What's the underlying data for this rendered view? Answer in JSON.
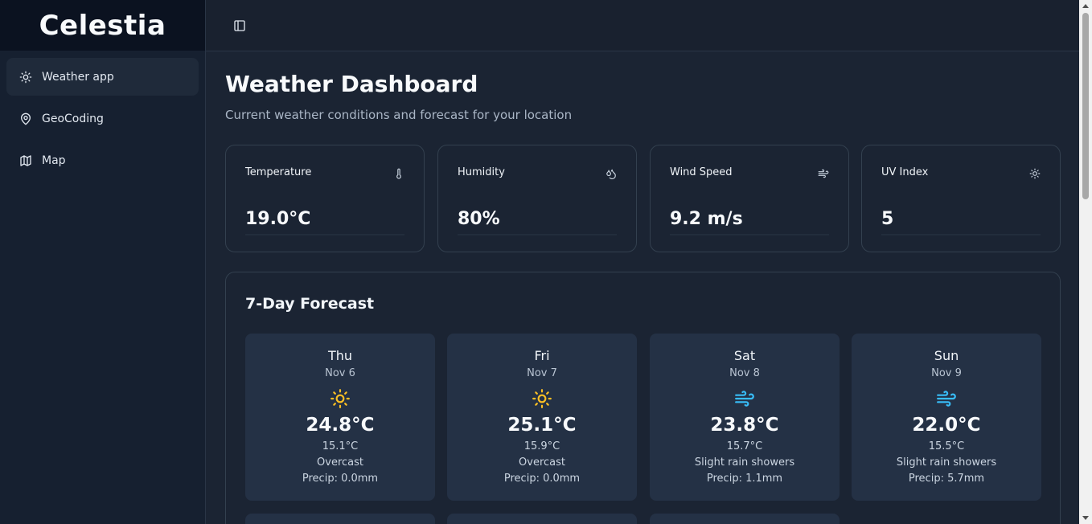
{
  "app": {
    "brand": "Celestia"
  },
  "sidebar": {
    "items": [
      {
        "label": "Weather app",
        "icon": "sun-icon",
        "active": true
      },
      {
        "label": "GeoCoding",
        "icon": "map-pin-icon"
      },
      {
        "label": "Map",
        "icon": "map-icon"
      }
    ]
  },
  "header": {
    "toggle_icon": "sidebar-toggle-icon"
  },
  "page": {
    "title": "Weather Dashboard",
    "subtitle": "Current weather conditions and forecast for your location"
  },
  "stats": [
    {
      "label": "Temperature",
      "value": "19.0°C",
      "icon": "thermometer-icon"
    },
    {
      "label": "Humidity",
      "value": "80%",
      "icon": "droplets-icon"
    },
    {
      "label": "Wind Speed",
      "value": "9.2 m/s",
      "icon": "wind-icon"
    },
    {
      "label": "UV Index",
      "value": "5",
      "icon": "sun-icon"
    }
  ],
  "forecast": {
    "title": "7-Day Forecast",
    "days": [
      {
        "day": "Thu",
        "date": "Nov 6",
        "max": "24.8°C",
        "min": "15.1°C",
        "condition": "Overcast",
        "precip": "Precip: 0.0mm",
        "icon": "sun-icon"
      },
      {
        "day": "Fri",
        "date": "Nov 7",
        "max": "25.1°C",
        "min": "15.9°C",
        "condition": "Overcast",
        "precip": "Precip: 0.0mm",
        "icon": "sun-icon"
      },
      {
        "day": "Sat",
        "date": "Nov 8",
        "max": "23.8°C",
        "min": "15.7°C",
        "condition": "Slight rain showers",
        "precip": "Precip: 1.1mm",
        "icon": "wind-icon"
      },
      {
        "day": "Sun",
        "date": "Nov 9",
        "max": "22.0°C",
        "min": "15.5°C",
        "condition": "Slight rain showers",
        "precip": "Precip: 5.7mm",
        "icon": "wind-icon"
      }
    ]
  },
  "colors": {
    "accent_sun": "#fbbf24",
    "accent_wind": "#38bdf8",
    "card_bg": "#243145",
    "background": "#1b2433"
  }
}
